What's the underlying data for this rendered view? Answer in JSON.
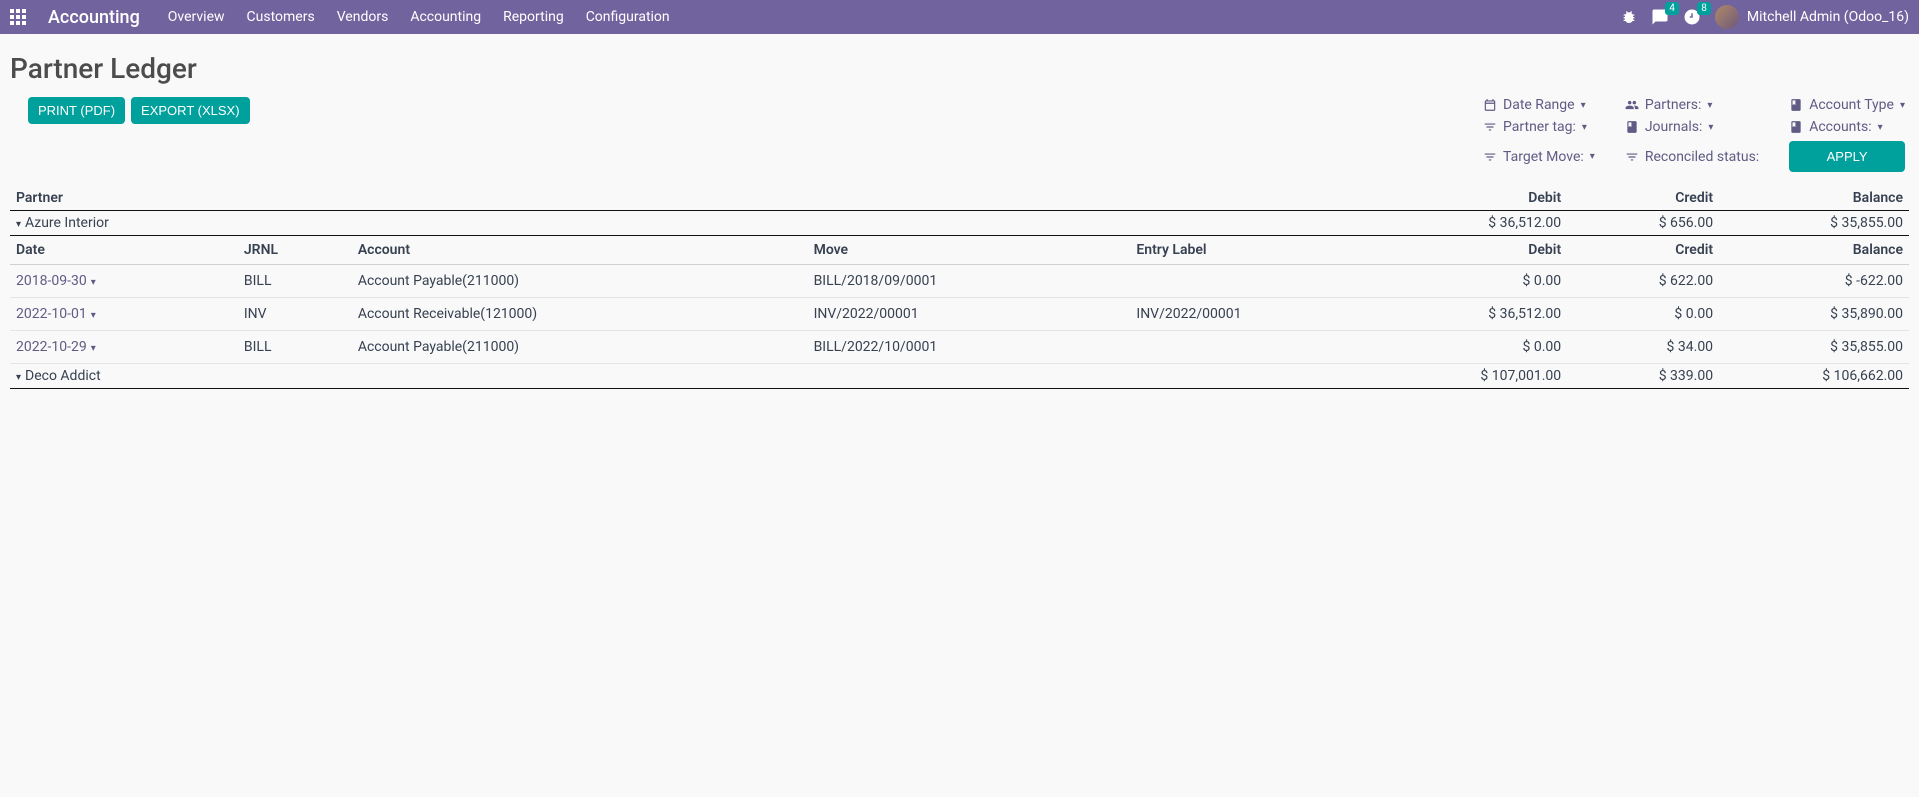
{
  "navbar": {
    "brand": "Accounting",
    "menu": [
      "Overview",
      "Customers",
      "Vendors",
      "Accounting",
      "Reporting",
      "Configuration"
    ],
    "messages_badge": "4",
    "activities_badge": "8",
    "user": "Mitchell Admin (Odoo_16)"
  },
  "page": {
    "title": "Partner Ledger",
    "btn_print": "PRINT (PDF)",
    "btn_export": "EXPORT (XLSX)",
    "btn_apply": "APPLY"
  },
  "filters": {
    "date_range": "Date Range",
    "partners": "Partners:",
    "account_type": "Account Type",
    "partner_tag": "Partner tag:",
    "journals": "Journals:",
    "accounts": "Accounts:",
    "target_move": "Target Move:",
    "reconciled": "Reconciled status:"
  },
  "table": {
    "headers": {
      "partner": "Partner",
      "debit": "Debit",
      "credit": "Credit",
      "balance": "Balance"
    },
    "detail_headers": {
      "date": "Date",
      "jrnl": "JRNL",
      "account": "Account",
      "move": "Move",
      "entry_label": "Entry Label",
      "debit": "Debit",
      "credit": "Credit",
      "balance": "Balance"
    },
    "partners": [
      {
        "name": "Azure Interior",
        "debit": "$ 36,512.00",
        "credit": "$ 656.00",
        "balance": "$ 35,855.00",
        "lines": [
          {
            "date": "2018-09-30",
            "jrnl": "BILL",
            "account": "Account Payable(211000)",
            "move": "BILL/2018/09/0001",
            "entry_label": "",
            "debit": "$ 0.00",
            "credit": "$ 622.00",
            "balance": "$ -622.00"
          },
          {
            "date": "2022-10-01",
            "jrnl": "INV",
            "account": "Account Receivable(121000)",
            "move": "INV/2022/00001",
            "entry_label": "INV/2022/00001",
            "debit": "$ 36,512.00",
            "credit": "$ 0.00",
            "balance": "$ 35,890.00"
          },
          {
            "date": "2022-10-29",
            "jrnl": "BILL",
            "account": "Account Payable(211000)",
            "move": "BILL/2022/10/0001",
            "entry_label": "",
            "debit": "$ 0.00",
            "credit": "$ 34.00",
            "balance": "$ 35,855.00"
          }
        ]
      },
      {
        "name": "Deco Addict",
        "debit": "$ 107,001.00",
        "credit": "$ 339.00",
        "balance": "$ 106,662.00",
        "lines": []
      }
    ]
  }
}
